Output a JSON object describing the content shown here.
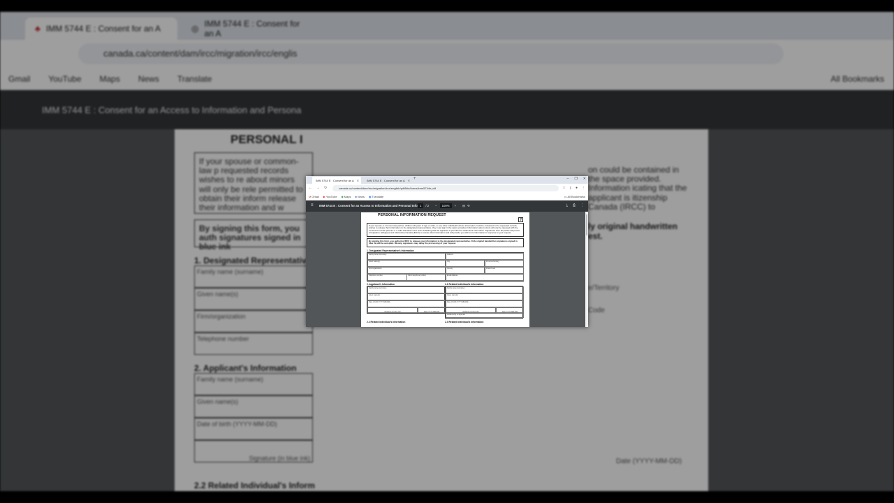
{
  "browser": {
    "tabs": [
      {
        "label": "IMM 5744 E : Consent for an A",
        "active": true,
        "icon": "maple-leaf-icon"
      },
      {
        "label": "IMM 5744 E : Consent for an A",
        "active": false,
        "icon": "globe-icon"
      }
    ],
    "new_tab": "+",
    "window_controls": {
      "minimize": "–",
      "restore": "❐",
      "close": "✕"
    },
    "address_url": "canada.ca/content/dam/ircc/migration/ircc/english/pdf/kits/forms/imm5744e.pdf",
    "bookmarks": [
      {
        "label": "Gmail",
        "icon": "gmail-icon"
      },
      {
        "label": "YouTube",
        "icon": "youtube-icon"
      },
      {
        "label": "Maps",
        "icon": "maps-icon"
      },
      {
        "label": "News",
        "icon": "news-icon"
      },
      {
        "label": "Translate",
        "icon": "translate-icon"
      }
    ],
    "all_bookmarks": "All Bookmarks"
  },
  "pdf_viewer": {
    "doc_title": "IMM 5744 E : Consent for an Access to Information and Personal Info...",
    "page_current": "1",
    "page_total": "/ 2",
    "zoom": "100%",
    "zoom_out": "–",
    "zoom_in": "+"
  },
  "document": {
    "title": "PERSONAL INFORMATION REQUEST",
    "help": "?",
    "intro": "If your spouse or common-law partner, children 18 years of age or older, or any other individuals whose information could be contained in the requested records wishes to release their information to the designated representative, they must sign in the space provided. Information about minors will only be released with the consent from both parents or a valid Canadian court order indicating that the applicant is permitted to obtain their information. Signatures from all parties will permit Immigration, Refugees and Citizenship Canada (IRCC) to release their information and will provide you with more information in response to your request.",
    "authorization": "By signing this form, you authorize IRCC to release your information to the designated representative. Only original handwritten signatures signed in blue ink will be accepted. Missing signatures may delay the processing of your request.",
    "section1": {
      "heading": "1. Designated Representative's Information",
      "fields": [
        "Family name (surname)",
        "Address",
        "",
        "Given name(s)",
        "City",
        "Province/Territory",
        "Firm/organization",
        "Country",
        "Postal Code",
        "Telephone number",
        "Other telephone number",
        "Email Address"
      ]
    },
    "section2": {
      "heading": "2. Applicant's Information",
      "fields": [
        "Family name (surname)",
        "Given name(s)",
        "Date of birth (YYYY-MM-DD)"
      ],
      "signature": "Signature (in blue ink)",
      "date": "Date (YYYY-MM-DD)"
    },
    "section21": {
      "heading": "2.1 Related Individual's Information",
      "fields": [
        "Family name (surname)",
        "Given name(s)",
        "Date of birth (YYYY-MM-DD)"
      ],
      "signature": "Signature (in blue ink)",
      "date": "Date (YYYY-MM-DD)",
      "relationship": "Relationship to applicant"
    },
    "section22": {
      "heading": "2.2 Related Individual's Information"
    },
    "section23": {
      "heading": "2.3 Related Individual's Information"
    }
  },
  "background": {
    "tab_label": "IMM 5744 E : Consent for an A",
    "address_url": "canada.ca/content/dam/ircc/migration/ircc/englis",
    "viewer_title": "IMM 5744 E : Consent for an Access to Information and Persona",
    "page_title": "PERSONAL I",
    "intro_fragment": "If your spouse or common-law p requested records wishes to re about minors will only be rele permitted to obtain their inform release their information and w",
    "auth_fragment": "By signing this form, you auth signatures signed in blue ink",
    "section1": "1. Designated Representative",
    "section2": "2. Applicant's Information",
    "section22": "2.2 Related Individual's Inform",
    "right_intro_fragment": "on could be contained in the space provided. Information icating that the applicant is itizenship Canada (IRCC) to",
    "right_auth_fragment": "ly original handwritten est.",
    "rows": [
      "Family name (surname)",
      "Given name(s)",
      "Firm/organization",
      "Telephone number"
    ],
    "app_rows": [
      "Family name (surname)",
      "Given name(s)",
      "Date of birth (YYYY-MM-DD)"
    ],
    "signature": "Signature (in blue ink)",
    "date": "Date (YYYY-MM-DD)",
    "right_labels": [
      "e/Territory",
      "Code"
    ]
  }
}
